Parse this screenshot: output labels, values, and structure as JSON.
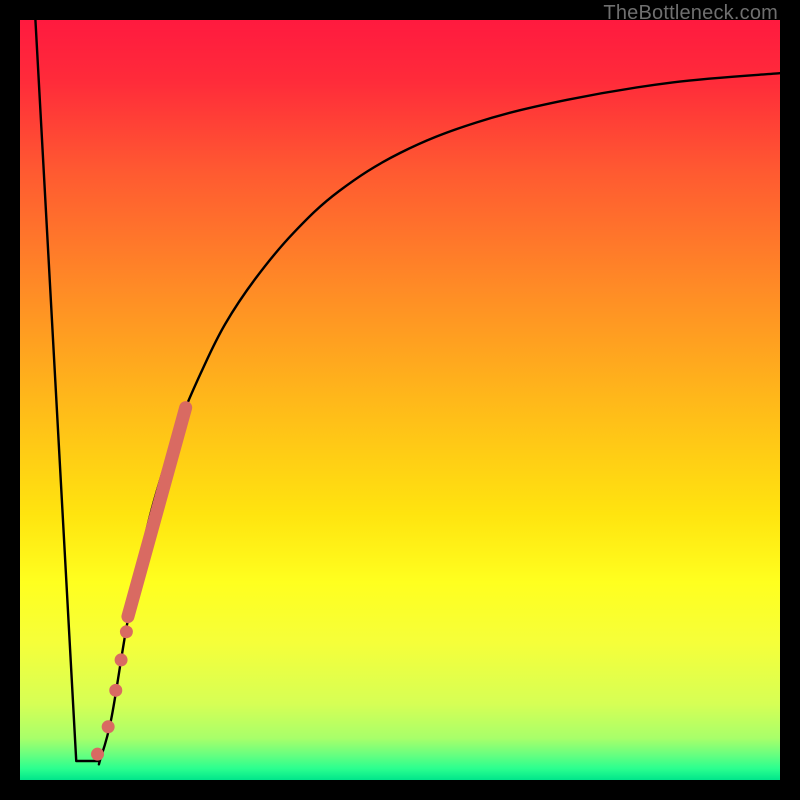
{
  "watermark": "TheBottleneck.com",
  "gradient": {
    "stops": [
      {
        "offset": 0.0,
        "color": "#ff1a3f"
      },
      {
        "offset": 0.08,
        "color": "#ff2b3a"
      },
      {
        "offset": 0.2,
        "color": "#ff5a31"
      },
      {
        "offset": 0.35,
        "color": "#ff8a26"
      },
      {
        "offset": 0.5,
        "color": "#ffb81a"
      },
      {
        "offset": 0.65,
        "color": "#ffe40f"
      },
      {
        "offset": 0.74,
        "color": "#ffff1f"
      },
      {
        "offset": 0.82,
        "color": "#f5ff3a"
      },
      {
        "offset": 0.9,
        "color": "#d6ff55"
      },
      {
        "offset": 0.945,
        "color": "#a8ff6a"
      },
      {
        "offset": 0.965,
        "color": "#6dff7e"
      },
      {
        "offset": 0.985,
        "color": "#2bff8f"
      },
      {
        "offset": 1.0,
        "color": "#00e58b"
      }
    ]
  },
  "chart_data": {
    "type": "line",
    "title": "",
    "xlabel": "",
    "ylabel": "",
    "xlim": [
      0,
      100
    ],
    "ylim": [
      0,
      100
    ],
    "series": [
      {
        "name": "curve",
        "x": [
          2,
          7,
          8.8,
          10.5,
          12,
          14,
          16,
          18,
          21,
          24,
          27,
          31,
          36,
          42,
          50,
          60,
          72,
          86,
          100
        ],
        "y": [
          100,
          25,
          2.5,
          2.5,
          8,
          20,
          30,
          38,
          47,
          54,
          60,
          66,
          72,
          77.5,
          82.5,
          86.5,
          89.5,
          91.8,
          93
        ]
      }
    ],
    "dip_segment": {
      "x0": 7.4,
      "y0": 2.5,
      "x1": 10.5,
      "y1": 2.5
    },
    "thick_segment": {
      "name": "highlight-band",
      "color": "#d96a62",
      "x0": 14.2,
      "y0": 21.5,
      "x1": 21.8,
      "y1": 49.0
    },
    "dots": {
      "name": "highlight-dots",
      "color": "#d96a62",
      "points": [
        {
          "x": 10.2,
          "y": 3.4
        },
        {
          "x": 11.6,
          "y": 7.0
        },
        {
          "x": 12.6,
          "y": 11.8
        },
        {
          "x": 13.3,
          "y": 15.8
        },
        {
          "x": 14.0,
          "y": 19.5
        }
      ]
    }
  }
}
